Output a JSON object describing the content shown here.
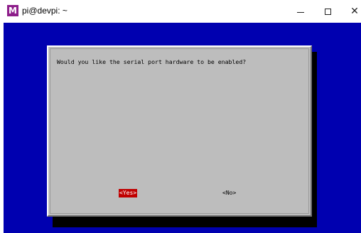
{
  "window": {
    "title": "pi@devpi: ~",
    "app_icon_letter": "M"
  },
  "dialog": {
    "prompt": "Would you like the serial port hardware to be enabled?",
    "buttons": {
      "yes": "<Yes>",
      "no": "<No>"
    }
  },
  "colors": {
    "terminal_background": "#0000b0",
    "dialog_background": "#bdbdbd",
    "selected_button": "#c00000",
    "app_icon": "#8d1e8a"
  },
  "icons": {
    "minimize": "minimize-icon",
    "maximize": "maximize-icon",
    "close": "close-icon"
  }
}
